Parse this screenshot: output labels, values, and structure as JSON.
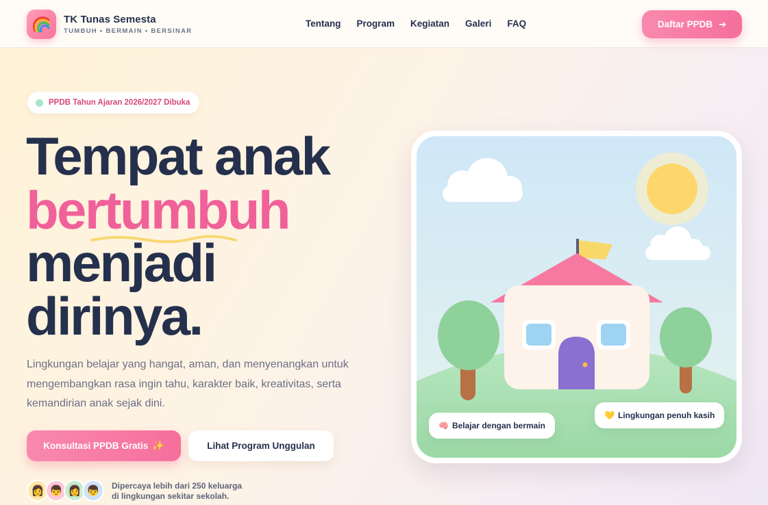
{
  "header": {
    "brand_name": "TK Tunas Semesta",
    "brand_tagline": "TUMBUH • BERMAIN • BERSINAR",
    "logo_icon": "rainbow-icon",
    "menu": [
      "Tentang",
      "Program",
      "Kegiatan",
      "Galeri",
      "FAQ"
    ],
    "cta_label": "Daftar PPDB",
    "cta_icon": "arrow-right-icon"
  },
  "hero": {
    "badge": "PPDB Tahun Ajaran 2026/2027 Dibuka",
    "headline": [
      "Tempat anak",
      "bertumbuh",
      "menjadi",
      "dirinya."
    ],
    "description": "Lingkungan belajar yang hangat, aman, dan menyenangkan untuk mengembangkan rasa ingin tahu, karakter baik, kreativitas, serta kemandirian anak sejak dini.",
    "primary_button": "Konsultasi PPDB Gratis",
    "secondary_button": "Lihat Program Unggulan",
    "trust_line1": "Dipercaya lebih dari 250 keluarga",
    "trust_line2": "di lingkungan sekitar sekolah.",
    "avatars": [
      "👩",
      "👦",
      "👩",
      "👦"
    ]
  },
  "illustration": {
    "tag1_icon": "🧠",
    "tag1": "Belajar dengan bermain",
    "tag2_icon": "💛",
    "tag2": "Lingkungan penuh kasih"
  },
  "colors": {
    "accent_pink": "#f0619a",
    "navy": "#25304d",
    "button_pink": "#f66f9c"
  }
}
